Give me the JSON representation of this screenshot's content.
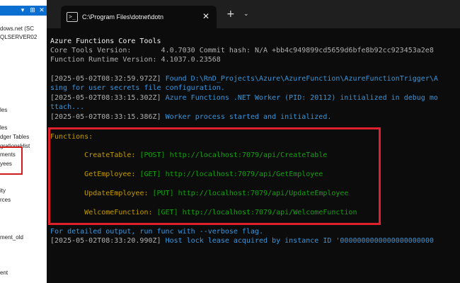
{
  "background_app": {
    "items": [
      "dows.net (SC",
      "QLSERVER02",
      "les",
      "les",
      "dger Tables",
      "grationsHist",
      "ments",
      "yees",
      "ity",
      "rces",
      "ment_old",
      "ent"
    ]
  },
  "terminal": {
    "tab_title": "C:\\Program Files\\dotnet\\dotn",
    "tab_close": "✕",
    "new_tab": "+",
    "dropdown": "⌄",
    "lines": {
      "l1": "Azure Functions Core Tools",
      "l2": "Core Tools Version:       4.0.7030 Commit hash: N/A +bb4c949899cd5659d6bfe8b92cc923453a2e8",
      "l3": "Function Runtime Version: 4.1037.0.23568",
      "l4a": "[2025-05-02T08:32:59.972Z] ",
      "l4b": "Found D:\\RnD_Projects\\Azure\\AzureFunction\\AzureFunctionTrigger\\A",
      "l5": "sing for user secrets file configuration.",
      "l6a": "[2025-05-02T08:33:15.302Z] ",
      "l6b": "Azure Functions .NET Worker (PID: 20112) initialized in debug mo",
      "l7": "ttach...",
      "l8a": "[2025-05-02T08:33:15.386Z] ",
      "l8b": "Worker process started and initialized.",
      "functions_header": "Functions:",
      "verbose": "For detailed output, run func with --verbose flag.",
      "lock_a": "[2025-05-02T08:33:20.990Z] ",
      "lock_b": "Host lock lease acquired by instance ID '0000000000000000000000"
    },
    "functions": [
      {
        "name": "CreateTable:",
        "method": "[POST]",
        "url": "http://localhost:7079/api/CreateTable"
      },
      {
        "name": "GetEmployee:",
        "method": "[GET]",
        "url": "http://localhost:7079/api/GetEmployee"
      },
      {
        "name": "UpdateEmployee:",
        "method": "[PUT]",
        "url": "http://localhost:7079/api/UpdateEmployee"
      },
      {
        "name": "WelcomeFunction:",
        "method": "[GET]",
        "url": "http://localhost:7079/api/WelcomeFunction"
      }
    ]
  },
  "colors": {
    "highlight_border": "#e0202a",
    "function_name": "#c19c00",
    "function_url": "#13a10e",
    "log_info": "#3a96dd"
  }
}
